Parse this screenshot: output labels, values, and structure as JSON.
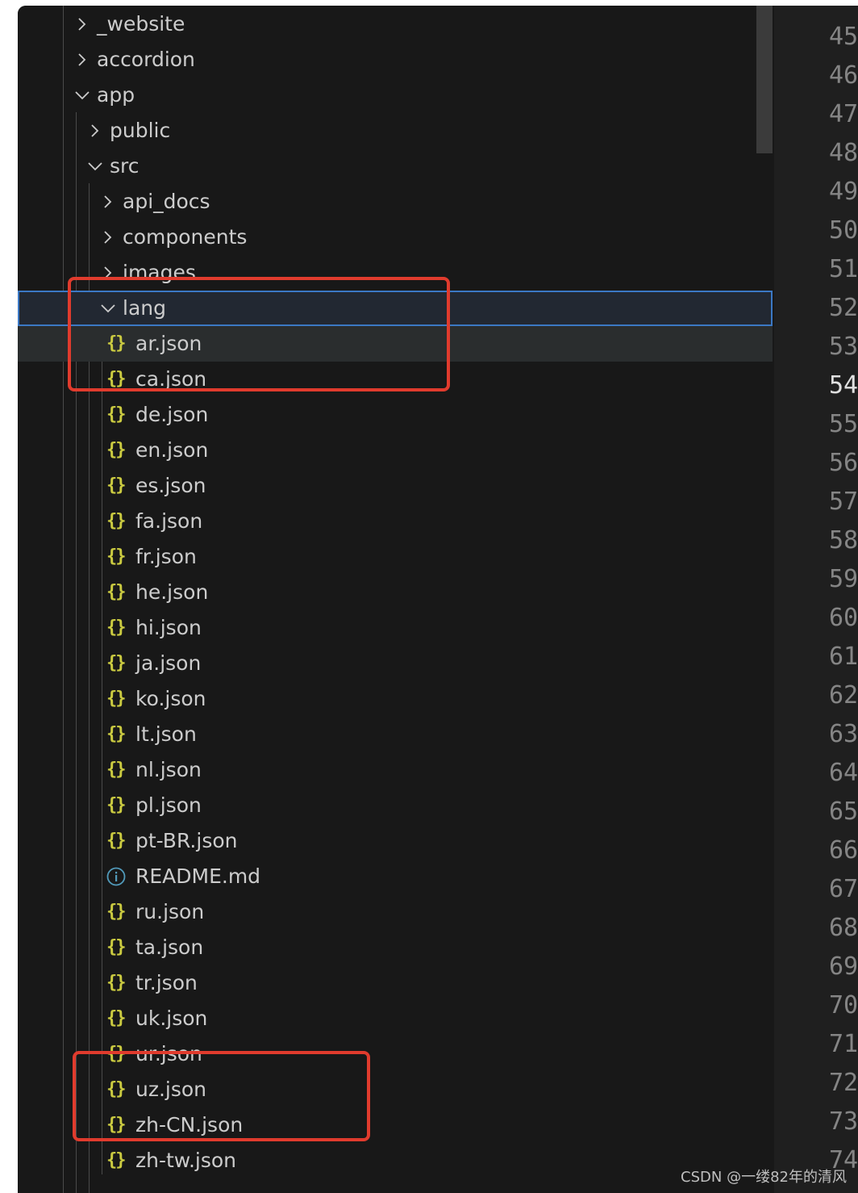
{
  "explorer": {
    "tree": [
      {
        "label": "_website",
        "kind": "folder",
        "state": "collapsed"
      },
      {
        "label": "accordion",
        "kind": "folder",
        "state": "collapsed"
      },
      {
        "label": "app",
        "kind": "folder",
        "state": "expanded"
      },
      {
        "label": "public",
        "kind": "folder",
        "state": "collapsed"
      },
      {
        "label": "src",
        "kind": "folder",
        "state": "expanded"
      },
      {
        "label": "api_docs",
        "kind": "folder",
        "state": "collapsed"
      },
      {
        "label": "components",
        "kind": "folder",
        "state": "collapsed"
      },
      {
        "label": "images",
        "kind": "folder",
        "state": "collapsed"
      },
      {
        "label": "lang",
        "kind": "folder",
        "state": "expanded",
        "selected": true
      },
      {
        "label": "ar.json",
        "kind": "json",
        "icon": "{}",
        "hover": true
      },
      {
        "label": "ca.json",
        "kind": "json",
        "icon": "{}"
      },
      {
        "label": "de.json",
        "kind": "json",
        "icon": "{}"
      },
      {
        "label": "en.json",
        "kind": "json",
        "icon": "{}"
      },
      {
        "label": "es.json",
        "kind": "json",
        "icon": "{}"
      },
      {
        "label": "fa.json",
        "kind": "json",
        "icon": "{}"
      },
      {
        "label": "fr.json",
        "kind": "json",
        "icon": "{}"
      },
      {
        "label": "he.json",
        "kind": "json",
        "icon": "{}"
      },
      {
        "label": "hi.json",
        "kind": "json",
        "icon": "{}"
      },
      {
        "label": "ja.json",
        "kind": "json",
        "icon": "{}"
      },
      {
        "label": "ko.json",
        "kind": "json",
        "icon": "{}"
      },
      {
        "label": "lt.json",
        "kind": "json",
        "icon": "{}"
      },
      {
        "label": "nl.json",
        "kind": "json",
        "icon": "{}"
      },
      {
        "label": "pl.json",
        "kind": "json",
        "icon": "{}"
      },
      {
        "label": "pt-BR.json",
        "kind": "json",
        "icon": "{}"
      },
      {
        "label": "README.md",
        "kind": "info",
        "icon": "i"
      },
      {
        "label": "ru.json",
        "kind": "json",
        "icon": "{}"
      },
      {
        "label": "ta.json",
        "kind": "json",
        "icon": "{}"
      },
      {
        "label": "tr.json",
        "kind": "json",
        "icon": "{}"
      },
      {
        "label": "uk.json",
        "kind": "json",
        "icon": "{}"
      },
      {
        "label": "ur.json",
        "kind": "json",
        "icon": "{}"
      },
      {
        "label": "uz.json",
        "kind": "json",
        "icon": "{}"
      },
      {
        "label": "zh-CN.json",
        "kind": "json",
        "icon": "{}"
      },
      {
        "label": "zh-tw.json",
        "kind": "json",
        "icon": "{}"
      }
    ]
  },
  "gutter": {
    "line_numbers": [
      "45",
      "46",
      "47",
      "48",
      "49",
      "50",
      "51",
      "52",
      "53",
      "54",
      "55",
      "56",
      "57",
      "58",
      "59",
      "60",
      "61",
      "62",
      "63",
      "64",
      "65",
      "66",
      "67",
      "68",
      "69",
      "70",
      "71",
      "72",
      "73",
      "74"
    ],
    "active_line": "54"
  },
  "watermark": "CSDN @一缕82年的清风",
  "colors": {
    "background": "#181818",
    "json_icon": "#cbcb41",
    "info_icon": "#519aba",
    "selection_border": "#3b78c4",
    "annotation": "#e03b2d"
  }
}
